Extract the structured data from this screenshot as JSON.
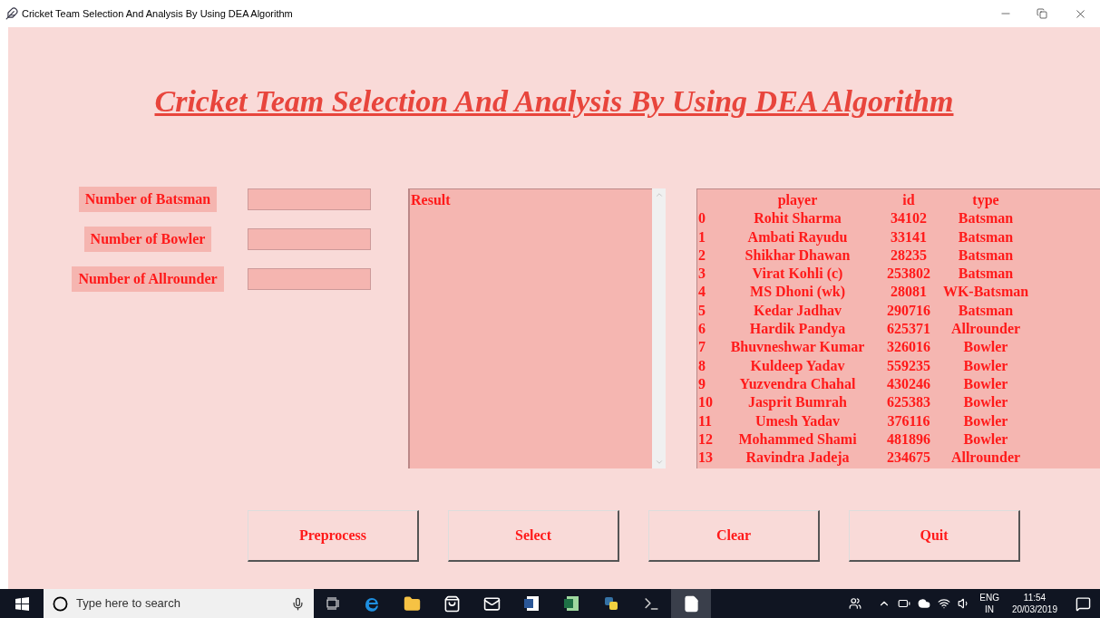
{
  "window": {
    "title": "Cricket Team Selection And Analysis By Using DEA Algorithm"
  },
  "heading": "Cricket Team Selection And Analysis By Using DEA Algorithm",
  "inputs": [
    {
      "label": "Number of Batsman"
    },
    {
      "label": "Number of Bowler"
    },
    {
      "label": "Number of Allrounder"
    }
  ],
  "result": {
    "text": "Result"
  },
  "players": {
    "columns": [
      "",
      "player",
      "id",
      "type"
    ],
    "rows": [
      [
        "0",
        "Rohit Sharma",
        "34102",
        "Batsman"
      ],
      [
        "1",
        "Ambati Rayudu",
        "33141",
        "Batsman"
      ],
      [
        "2",
        "Shikhar Dhawan",
        "28235",
        "Batsman"
      ],
      [
        "3",
        "Virat Kohli (c)",
        "253802",
        "Batsman"
      ],
      [
        "4",
        "MS Dhoni (wk)",
        "28081",
        "WK-Batsman"
      ],
      [
        "5",
        "Kedar Jadhav",
        "290716",
        "Batsman"
      ],
      [
        "6",
        "Hardik Pandya",
        "625371",
        "Allrounder"
      ],
      [
        "7",
        "Bhuvneshwar Kumar",
        "326016",
        "Bowler"
      ],
      [
        "8",
        "Kuldeep Yadav",
        "559235",
        "Bowler"
      ],
      [
        "9",
        "Yuzvendra Chahal",
        "430246",
        "Bowler"
      ],
      [
        "10",
        "Jasprit Bumrah",
        "625383",
        "Bowler"
      ],
      [
        "11",
        "Umesh Yadav",
        "376116",
        "Bowler"
      ],
      [
        "12",
        "Mohammed Shami",
        "481896",
        "Bowler"
      ],
      [
        "13",
        "Ravindra Jadeja",
        "234675",
        "Allrounder"
      ]
    ]
  },
  "buttons": [
    "Preprocess",
    "Select",
    "Clear",
    "Quit"
  ],
  "taskbar": {
    "search_placeholder": "Type here to search",
    "language": "ENG",
    "region": "IN",
    "time": "11:54",
    "date": "20/03/2019"
  }
}
